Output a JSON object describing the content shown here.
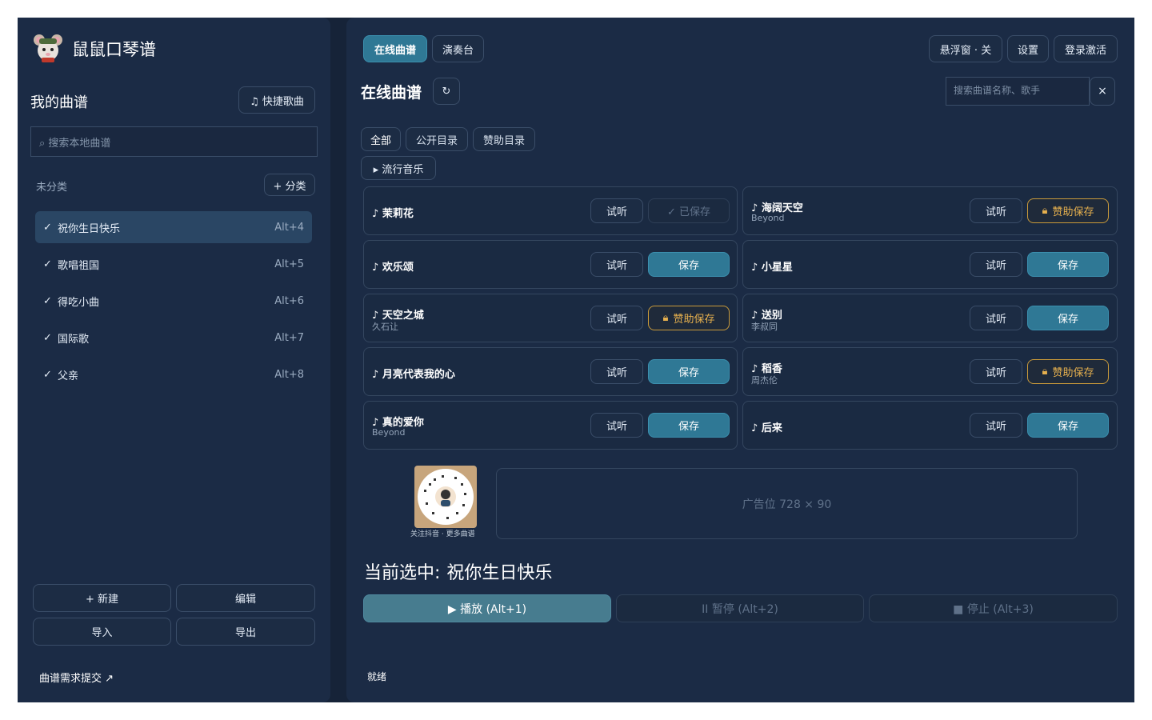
{
  "app": {
    "title": "鼠鼠口琴谱"
  },
  "sidebar": {
    "section_title": "我的曲谱",
    "quick_button": "♫ 快捷歌曲",
    "search_placeholder": "⌕ 搜索本地曲谱",
    "category_label": "未分类",
    "add_category_button": "+ 分类",
    "items": [
      {
        "check": "✓",
        "name": "祝你生日快乐",
        "key": "Alt+4",
        "selected": true
      },
      {
        "check": "✓",
        "name": "歌唱祖国",
        "key": "Alt+5"
      },
      {
        "check": "✓",
        "name": "得吃小曲",
        "key": "Alt+6"
      },
      {
        "check": "✓",
        "name": "国际歌",
        "key": "Alt+7"
      },
      {
        "check": "✓",
        "name": "父亲",
        "key": "Alt+8"
      }
    ],
    "new_button": "+ 新建",
    "edit_button": "编辑",
    "import_button": "导入",
    "export_button": "导出",
    "request_link": "曲谱需求提交 ↗"
  },
  "topbar": {
    "tabs": [
      {
        "label": "在线曲谱",
        "active": true
      },
      {
        "label": "演奏台",
        "active": false
      }
    ],
    "float_button": "悬浮窗 · 关",
    "settings_button": "设置",
    "login_button": "登录激活"
  },
  "online": {
    "title": "在线曲谱",
    "refresh_icon": "↻",
    "search_placeholder": "搜索曲谱名称、歌手",
    "clear_icon": "×",
    "filters": [
      "全部",
      "公开目录",
      "赞助目录"
    ],
    "category": "▸ 流行音乐",
    "songs": [
      {
        "title": "♪ 茉莉花",
        "artist": "",
        "listen": "试听",
        "action": "✓ 已保存",
        "state": "saved"
      },
      {
        "title": "♪ 海阔天空",
        "artist": "Beyond",
        "listen": "试听",
        "action": "赞助保存",
        "state": "sponsor"
      },
      {
        "title": "♪ 欢乐颂",
        "artist": "",
        "listen": "试听",
        "action": "保存",
        "state": "save"
      },
      {
        "title": "♪ 小星星",
        "artist": "",
        "listen": "试听",
        "action": "保存",
        "state": "save"
      },
      {
        "title": "♪ 天空之城",
        "artist": "久石让",
        "listen": "试听",
        "action": "赞助保存",
        "state": "sponsor"
      },
      {
        "title": "♪ 送别",
        "artist": "李叔同",
        "listen": "试听",
        "action": "保存",
        "state": "save"
      },
      {
        "title": "♪ 月亮代表我的心",
        "artist": "",
        "listen": "试听",
        "action": "保存",
        "state": "save"
      },
      {
        "title": "♪ 稻香",
        "artist": "周杰伦",
        "listen": "试听",
        "action": "赞助保存",
        "state": "sponsor"
      },
      {
        "title": "♪ 真的爱你",
        "artist": "Beyond",
        "listen": "试听",
        "action": "保存",
        "state": "save"
      },
      {
        "title": "♪ 后来",
        "artist": "",
        "listen": "试听",
        "action": "保存",
        "state": "save"
      }
    ]
  },
  "promo": {
    "qr_caption": "关注抖音 · 更多曲谱",
    "ad_text": "广告位 728 × 90"
  },
  "player": {
    "current_label": "当前选中:",
    "current_song": "祝你生日快乐",
    "play_button": "▶ 播放 (Alt+1)",
    "pause_button": "II 暂停 (Alt+2)",
    "stop_button": "■ 停止 (Alt+3)",
    "status": "就绪"
  },
  "colors": {
    "primary": "#2f7895",
    "gold": "#e6b04e",
    "panel": "#1b2b45",
    "background": "#162338"
  }
}
